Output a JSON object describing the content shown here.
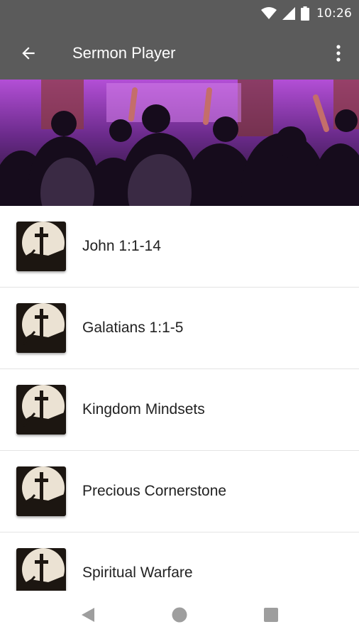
{
  "status_bar": {
    "time": "10:26",
    "icons": [
      "wifi-icon",
      "cell-signal-icon",
      "battery-icon"
    ]
  },
  "app_bar": {
    "title": "Sermon Player",
    "back_icon": "arrow-back-icon",
    "menu_icon": "more-vert-icon"
  },
  "banner": {
    "image": "worship-crowd-photo"
  },
  "sermons": [
    {
      "title": "John 1:1-14",
      "thumbnail": "cross-thumbnail"
    },
    {
      "title": "Galatians 1:1-5",
      "thumbnail": "cross-thumbnail"
    },
    {
      "title": "Kingdom Mindsets",
      "thumbnail": "cross-thumbnail"
    },
    {
      "title": "Precious Cornerstone",
      "thumbnail": "cross-thumbnail"
    },
    {
      "title": "Spiritual Warfare",
      "thumbnail": "cross-thumbnail"
    }
  ],
  "nav_bar": {
    "buttons": [
      "back-triangle-icon",
      "home-circle-icon",
      "recents-square-icon"
    ]
  },
  "colors": {
    "app_bar": "#5b5b5b",
    "text": "#222222",
    "divider": "#e4e4e4",
    "nav_icons": "#9e9e9e"
  }
}
